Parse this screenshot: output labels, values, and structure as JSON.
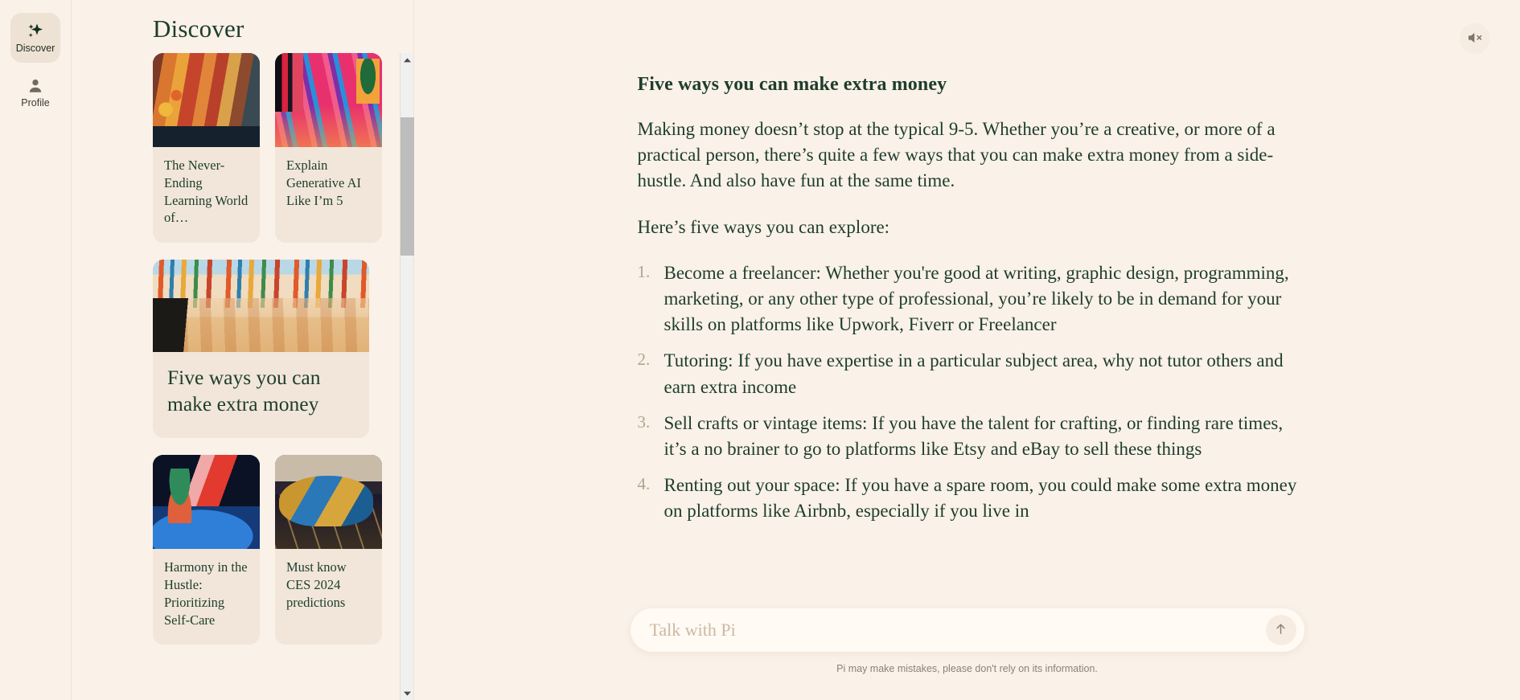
{
  "colors": {
    "page_bg": "#faf1e8",
    "card_bg": "#f1e6d9",
    "text_green": "#1d3d2c",
    "list_number": "#b2a38f",
    "placeholder": "#cdb9a3",
    "scrollbar_thumb": "#bdbdbd",
    "rail_active_bg": "#ede2d4"
  },
  "rail": {
    "items": [
      {
        "label": "Discover",
        "icon": "sparkle-icon",
        "active": true
      },
      {
        "label": "Profile",
        "icon": "person-icon",
        "active": false
      }
    ]
  },
  "discover": {
    "title": "Discover",
    "rows": [
      {
        "cards": [
          {
            "title": "The Never-Ending Learning World of…",
            "image": "books-shelf-illustration",
            "size": "small"
          },
          {
            "title": "Explain Generative AI Like I’m 5",
            "image": "pink-tiled-street-illustration",
            "size": "small"
          }
        ]
      },
      {
        "cards": [
          {
            "title": "Five ways you can make extra money",
            "image": "art-gallery-illustration",
            "size": "wide"
          }
        ]
      },
      {
        "cards": [
          {
            "title": "Harmony in the Hustle: Prioritizing Self-Care",
            "image": "teapot-window-illustration",
            "size": "small"
          },
          {
            "title": "Must know CES 2024 predictions",
            "image": "concept-car-photo",
            "size": "small"
          }
        ]
      }
    ]
  },
  "scrollbar": {
    "up_arrow_icon": "chevron-up-icon",
    "down_arrow_icon": "chevron-down-icon"
  },
  "header": {
    "mute_icon": "speaker-muted-icon"
  },
  "article": {
    "heading": "Five ways you can make extra money",
    "paragraphs": [
      "Making money doesn’t stop at the typical 9-5. Whether you’re a creative, or more of a practical person, there’s quite a few ways that you can make extra money from a side-hustle. And also have fun at the same time.",
      "Here’s five ways you can explore:"
    ],
    "list": [
      "Become a freelancer: Whether you're good at writing, graphic design, programming, marketing, or any other type of professional, you’re likely to be in demand for your skills on platforms like Upwork, Fiverr or Freelancer",
      "Tutoring: If you have expertise in a particular subject area, why not tutor others and earn extra income",
      "Sell crafts or vintage items: If you have the talent for crafting, or finding rare times, it’s a no brainer to go to platforms like Etsy and eBay to sell these things",
      "Renting out your space: If you have a spare room, you could make some extra money on platforms like Airbnb, especially if you live in"
    ]
  },
  "composer": {
    "placeholder": "Talk with Pi",
    "value": "",
    "send_icon": "arrow-up-icon",
    "disclaimer": "Pi may make mistakes, please don't rely on its information."
  }
}
